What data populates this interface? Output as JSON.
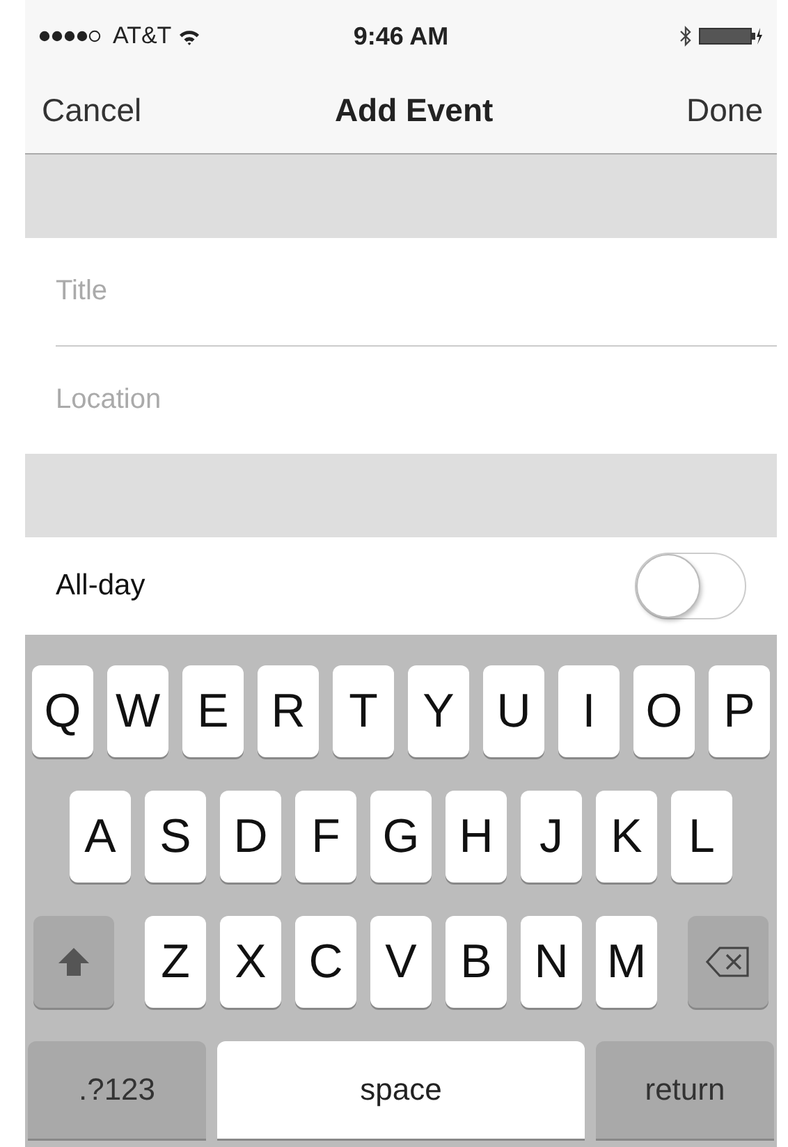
{
  "status_bar": {
    "carrier": "AT&T",
    "time": "9:46 AM"
  },
  "nav_bar": {
    "cancel": "Cancel",
    "title": "Add Event",
    "done": "Done"
  },
  "fields": [
    {
      "placeholder": "Title"
    },
    {
      "placeholder": "Location"
    }
  ],
  "all_day": {
    "label": "All-day",
    "on": false
  },
  "keyboard": {
    "rows": [
      [
        {
          "kind": "letter",
          "label": "Q"
        },
        {
          "kind": "letter",
          "label": "W"
        },
        {
          "kind": "letter",
          "label": "E"
        },
        {
          "kind": "letter",
          "label": "R"
        },
        {
          "kind": "letter",
          "label": "T"
        },
        {
          "kind": "letter",
          "label": "Y"
        },
        {
          "kind": "letter",
          "label": "U"
        },
        {
          "kind": "letter",
          "label": "I"
        },
        {
          "kind": "letter",
          "label": "O"
        },
        {
          "kind": "letter",
          "label": "P"
        }
      ],
      [
        {
          "kind": "letter",
          "label": "A"
        },
        {
          "kind": "letter",
          "label": "S"
        },
        {
          "kind": "letter",
          "label": "D"
        },
        {
          "kind": "letter",
          "label": "F"
        },
        {
          "kind": "letter",
          "label": "G"
        },
        {
          "kind": "letter",
          "label": "H"
        },
        {
          "kind": "letter",
          "label": "J"
        },
        {
          "kind": "letter",
          "label": "K"
        },
        {
          "kind": "letter",
          "label": "L"
        }
      ],
      [
        {
          "kind": "shift"
        },
        {
          "kind": "letter",
          "label": "Z"
        },
        {
          "kind": "letter",
          "label": "X"
        },
        {
          "kind": "letter",
          "label": "C"
        },
        {
          "kind": "letter",
          "label": "V"
        },
        {
          "kind": "letter",
          "label": "B"
        },
        {
          "kind": "letter",
          "label": "N"
        },
        {
          "kind": "letter",
          "label": "M"
        },
        {
          "kind": "delete"
        }
      ]
    ],
    "bottom_bar": [
      {
        "kind": "mode",
        "label": ".?123"
      },
      {
        "kind": "space",
        "label": "space"
      },
      {
        "kind": "return",
        "label": "return"
      }
    ]
  }
}
